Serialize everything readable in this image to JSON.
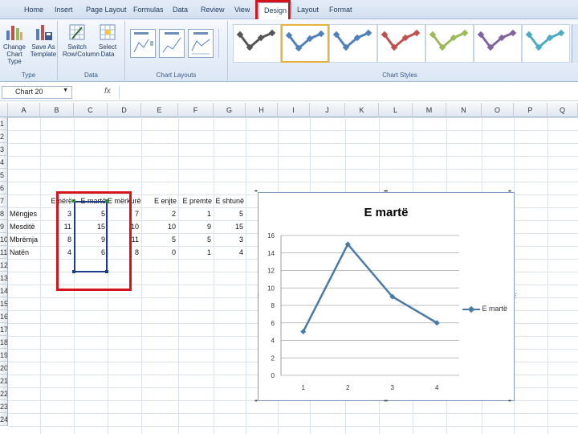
{
  "tabs": [
    {
      "label": "Home"
    },
    {
      "label": "Insert"
    },
    {
      "label": "Page Layout"
    },
    {
      "label": "Formulas"
    },
    {
      "label": "Data"
    },
    {
      "label": "Review"
    },
    {
      "label": "View"
    },
    {
      "label": "Design"
    },
    {
      "label": "Layout"
    },
    {
      "label": "Format"
    }
  ],
  "ribbon": {
    "type_group": {
      "label": "Type",
      "change": "Change Chart Type",
      "save": "Save As Template"
    },
    "data_group": {
      "label": "Data",
      "switch": "Switch Row/Column",
      "select": "Select Data"
    },
    "layouts_group": {
      "label": "Chart Layouts"
    },
    "styles_group": {
      "label": "Chart Styles",
      "style_colors": [
        "#555555",
        "#4f81bd",
        "#4f81bd",
        "#c0504d",
        "#9bbb59",
        "#8064a2",
        "#4bacc6"
      ]
    }
  },
  "formula_bar": {
    "name_box": "Chart 20",
    "fx": "fx",
    "formula": ""
  },
  "columns": [
    "A",
    "B",
    "C",
    "D",
    "E",
    "F",
    "G",
    "H",
    "I",
    "J",
    "K",
    "L",
    "M",
    "N",
    "O",
    "P",
    "Q"
  ],
  "rows": [
    "1",
    "2",
    "3",
    "4",
    "5",
    "6",
    "7",
    "8",
    "9",
    "10",
    "11",
    "12",
    "13",
    "14",
    "15",
    "16",
    "17",
    "18",
    "19",
    "20",
    "21",
    "22",
    "23",
    "24"
  ],
  "sheet": {
    "headers": [
      "Emërë",
      "E martë",
      "E mërkurë",
      "E enjte",
      "E premte",
      "E shtunë"
    ],
    "row_labels": [
      "Mëngjes",
      "Mesditë",
      "Mbrëmja",
      "Natën"
    ],
    "values": [
      [
        "3",
        "5",
        "7",
        "2",
        "1",
        "5"
      ],
      [
        "11",
        "15",
        "10",
        "10",
        "9",
        "15"
      ],
      [
        "8",
        "9",
        "11",
        "5",
        "5",
        "3"
      ],
      [
        "4",
        "6",
        "8",
        "0",
        "1",
        "4"
      ]
    ]
  },
  "chart_data": {
    "type": "line",
    "title": "E martë",
    "x": [
      "1",
      "2",
      "3",
      "4"
    ],
    "series": [
      {
        "name": "E martë",
        "values": [
          5,
          15,
          9,
          6
        ],
        "color": "#4a7aa8"
      }
    ],
    "yticks": [
      "0",
      "2",
      "4",
      "6",
      "8",
      "10",
      "12",
      "14",
      "16"
    ],
    "ylim": [
      0,
      16
    ],
    "grid": true,
    "legend": "right"
  }
}
